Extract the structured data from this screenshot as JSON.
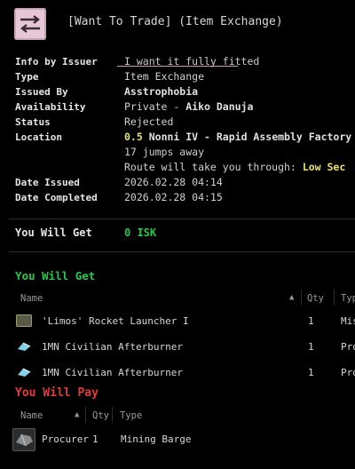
{
  "header": {
    "title": "[Want To Trade] (Item Exchange)",
    "icon": "contract-exchange-icon"
  },
  "info": {
    "labels": {
      "info": "Info by Issuer",
      "type": "Type",
      "issued_by": "Issued By",
      "availability": "Availability",
      "status": "Status",
      "location": "Location",
      "date_issued": "Date Issued",
      "date_completed": "Date Completed"
    },
    "values": {
      "info": "I want it fully fitted",
      "type": "Item Exchange",
      "issued_by": "Asstrophobia",
      "availability_prefix": "Private - ",
      "availability_name": "Aiko Danuja",
      "status": "Rejected",
      "location_sec": "0.5",
      "location_name": "Nonni IV - Rapid Assembly Factory",
      "jumps": "17 jumps away",
      "route_text": "Route will take you through:",
      "route_sec": "Low Sec",
      "date_issued": "2026.02.28 04:14",
      "date_completed": "2026.02.28 04:15"
    }
  },
  "get_isk": {
    "label": "You Will Get",
    "value": "0 ISK"
  },
  "get_section": {
    "title": "You Will Get",
    "columns": {
      "name": "Name",
      "qty": "Qty",
      "type": "Typ"
    },
    "items": [
      {
        "name": "'Limos' Rocket Launcher I",
        "qty": "1",
        "type": "Mis",
        "icon": "rocket-launcher-icon"
      },
      {
        "name": "1MN Civilian Afterburner",
        "qty": "1",
        "type": "Pro",
        "icon": "afterburner-icon"
      },
      {
        "name": "1MN Civilian Afterburner",
        "qty": "1",
        "type": "Pro",
        "icon": "afterburner-icon"
      }
    ]
  },
  "pay_section": {
    "title": "You Will Pay",
    "columns": {
      "name": "Name",
      "qty": "Qty",
      "type": "Type"
    },
    "items": [
      {
        "name": "Procurer",
        "qty": "1",
        "type": "Mining Barge",
        "icon": "ship-icon"
      }
    ]
  },
  "colors": {
    "green": "#23c94b",
    "red": "#e53a3a",
    "yellow": "#e7e26a"
  }
}
